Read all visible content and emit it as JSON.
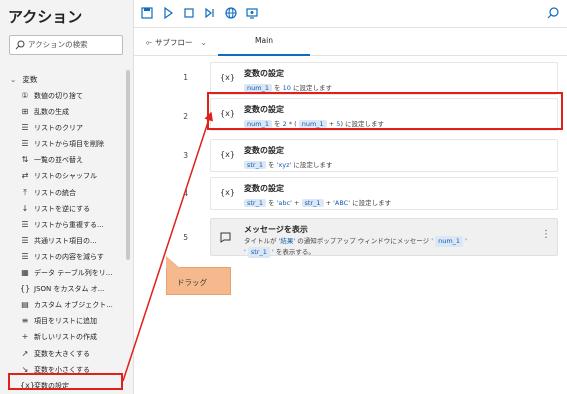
{
  "left_panel": {
    "title": "アクション",
    "search_placeholder": "アクションの検索",
    "category": "変数",
    "actions": [
      {
        "icon": "①",
        "label": "数値の切り捨て"
      },
      {
        "icon": "⊞",
        "label": "乱数の生成"
      },
      {
        "icon": "☰",
        "label": "リストのクリア"
      },
      {
        "icon": "☰",
        "label": "リストから項目を削除"
      },
      {
        "icon": "⇅",
        "label": "一覧の並べ替え"
      },
      {
        "icon": "⇄",
        "label": "リストのシャッフル"
      },
      {
        "icon": "⤒",
        "label": "リストの統合"
      },
      {
        "icon": "↓",
        "label": "リストを逆にする"
      },
      {
        "icon": "☰",
        "label": "リストから重複する..."
      },
      {
        "icon": "☰",
        "label": "共通リスト項目の..."
      },
      {
        "icon": "☰",
        "label": "リストの内容を減らす"
      },
      {
        "icon": "▦",
        "label": "データ テーブル列をリ..."
      },
      {
        "icon": "{}",
        "label": "JSON をカスタム オ..."
      },
      {
        "icon": "▤",
        "label": "カスタム オブジェクト..."
      },
      {
        "icon": "≡",
        "label": "項目をリストに追加"
      },
      {
        "icon": "+",
        "label": "新しいリストの作成"
      },
      {
        "icon": "↗",
        "label": "変数を大きくする"
      },
      {
        "icon": "↘",
        "label": "変数を小さくする"
      },
      {
        "icon": "{x}",
        "label": "変数の設定"
      }
    ]
  },
  "tabs": {
    "subflow_label": "サブフロー",
    "main_label": "Main"
  },
  "steps": [
    {
      "line": "1",
      "icon": "{x}",
      "title": "変数の設定"
    },
    {
      "line": "2",
      "icon": "{x}",
      "title": "変数の設定"
    },
    {
      "line": "3",
      "icon": "{x}",
      "title": "変数の設定"
    },
    {
      "line": "4",
      "icon": "{x}",
      "title": "変数の設定"
    },
    {
      "line": "5",
      "icon": "message-icon",
      "title": "メッセージを表示"
    }
  ],
  "step_desc": {
    "s1": {
      "var": "num_1",
      "t1": " を ",
      "val": "10",
      "t2": " に設定します"
    },
    "s2": {
      "var": "num_1",
      "t1": " を ",
      "lit1": "2",
      "t2": " * ( ",
      "var2": "num_1",
      "t3": " + ",
      "lit2": "5",
      "t4": ") に設定します"
    },
    "s3": {
      "var": "str_1",
      "t1": " を ",
      "lit": "'xyz'",
      "t2": " に設定します"
    },
    "s4": {
      "var": "str_1",
      "t1": " を ",
      "lit1": "'abc'",
      "t2": " + ",
      "var2": "str_1",
      "t3": " + ",
      "lit2": "'ABC'",
      "t4": " に設定します"
    },
    "s5": {
      "t1": "タイトルが ",
      "lit1": "'結果'",
      "t2": " の通知ポップアップ ウィンドウにメッセージ ",
      "lit2": "'",
      "var1": "num_1",
      "lit3": "'",
      "lit4": "'",
      "var2": "str_1",
      "lit5": "'",
      "t3": " を表示する。"
    }
  },
  "drag_label": "ドラッグ",
  "colors": {
    "highlight": "#e0201b",
    "accent": "#0f6cbd",
    "drag_label_bg": "#f5b98d"
  }
}
